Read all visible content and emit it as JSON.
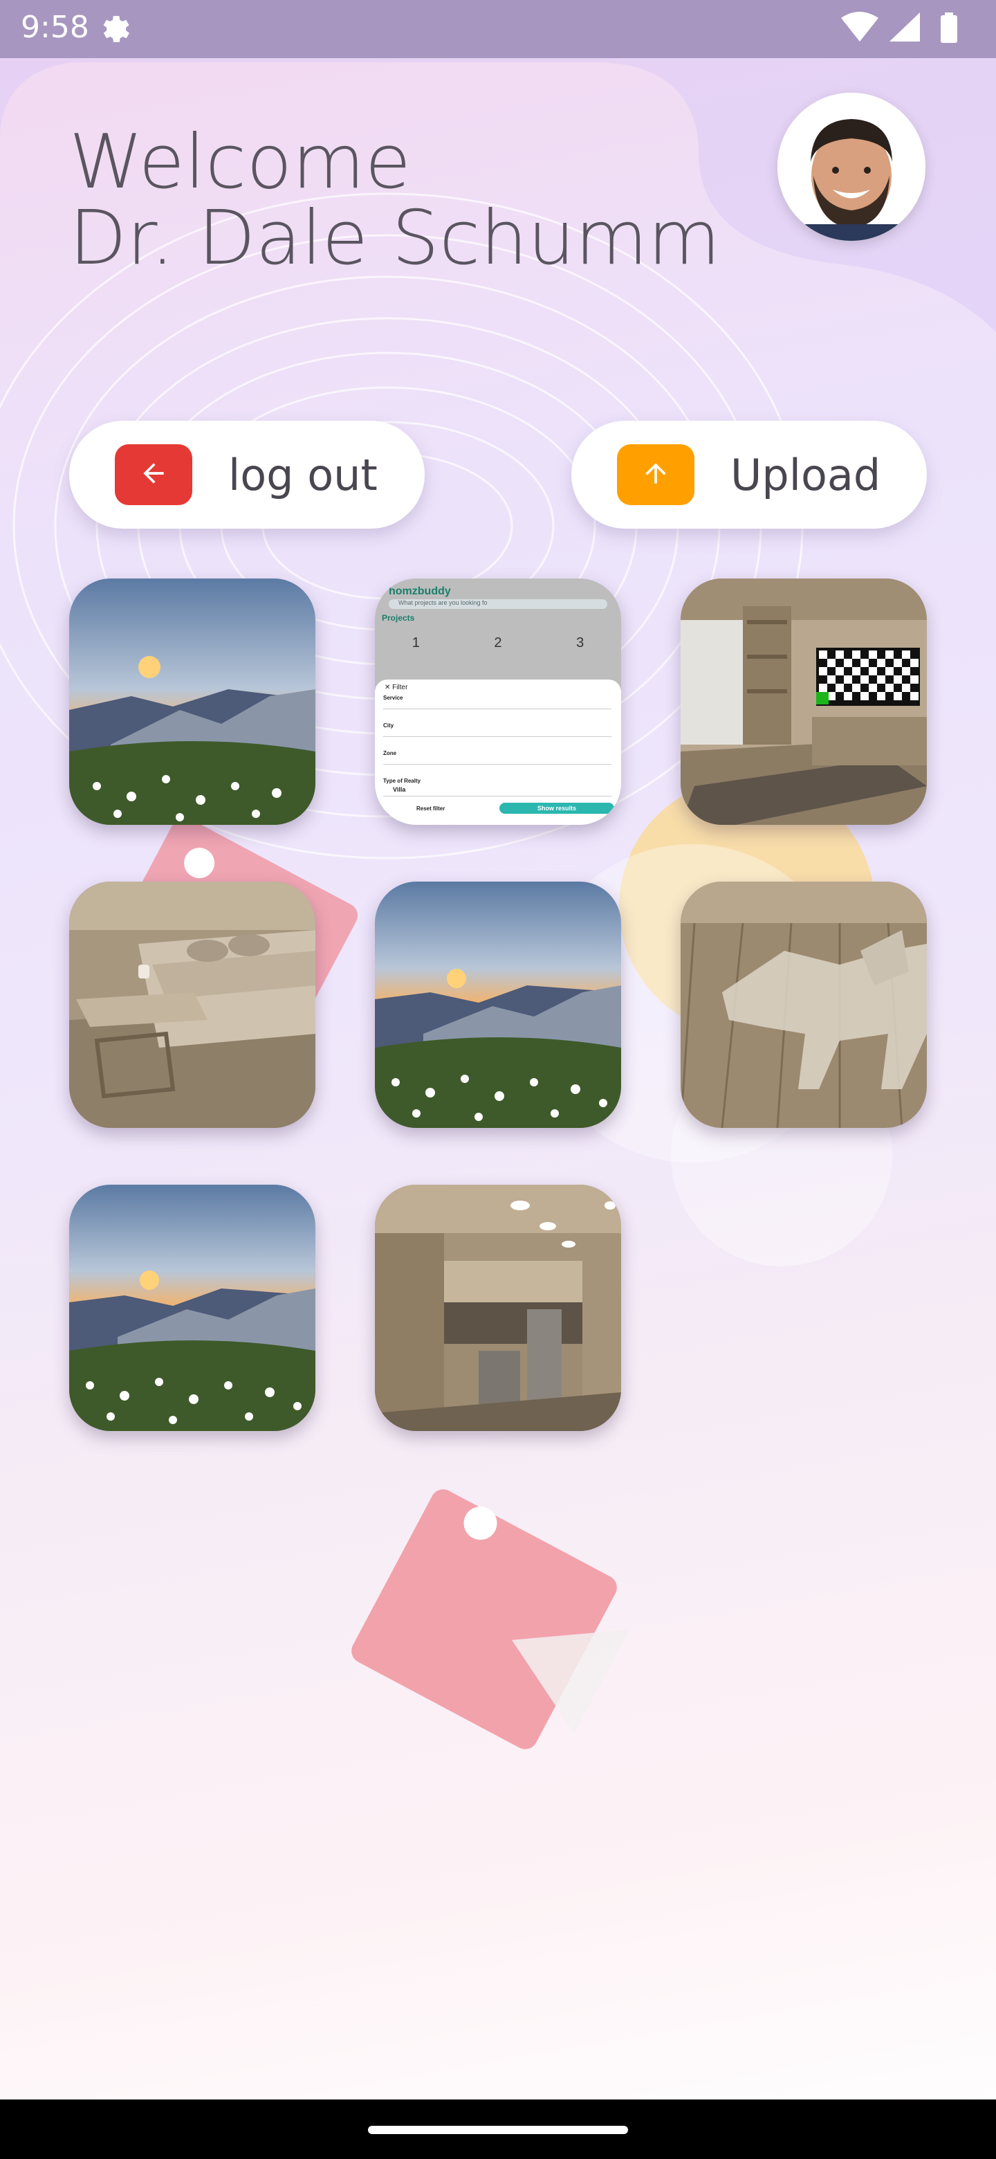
{
  "status_bar": {
    "time": "9:58",
    "icons": [
      "settings-gear-icon",
      "wifi-icon",
      "signal-icon",
      "battery-icon"
    ]
  },
  "header": {
    "greeting": "Welcome",
    "user_name": "Dr. Dale Schumm",
    "avatar": "user-avatar"
  },
  "actions": {
    "logout_label": "log out",
    "logout_color": "#e53935",
    "upload_label": "Upload",
    "upload_color": "#ffa000"
  },
  "gallery": {
    "images": [
      {
        "kind": "mountain-sunset"
      },
      {
        "kind": "app-screenshot-filter"
      },
      {
        "kind": "room-tv"
      },
      {
        "kind": "room-sofa"
      },
      {
        "kind": "mountain-sunset"
      },
      {
        "kind": "room-dog"
      },
      {
        "kind": "mountain-sunset"
      },
      {
        "kind": "kitchen"
      }
    ]
  },
  "screenshot_tile": {
    "brand": "homzbuddy",
    "search_placeholder": "What projects are you looking fo",
    "section": "Projects",
    "keypad": [
      "1",
      "2",
      "3"
    ],
    "filter_title": "Filter",
    "fields": [
      "Service",
      "City",
      "Zone",
      "Type of Realty"
    ],
    "realty_value": "Villa",
    "reset": "Reset filter",
    "show": "Show results"
  }
}
